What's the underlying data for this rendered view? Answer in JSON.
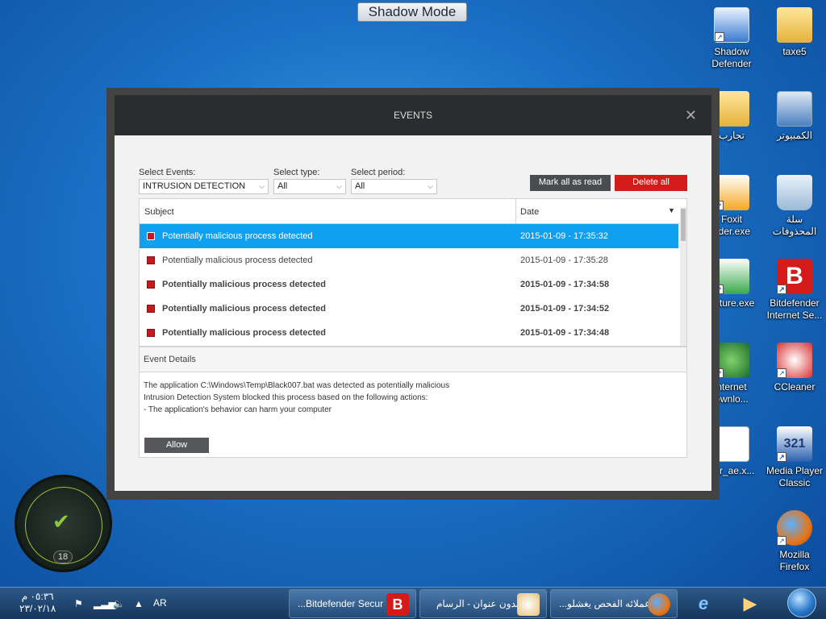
{
  "shadow_banner": "Shadow Mode",
  "desktop_icons": [
    {
      "label": "Shadow Defender",
      "icon": "shadow-defender-icon"
    },
    {
      "label": "taxe5",
      "icon": "folder-user-icon"
    },
    {
      "label": "تجارب",
      "icon": "folder-icon"
    },
    {
      "label": "الكمبيوتر",
      "icon": "computer-icon"
    },
    {
      "label": "Foxit\nader.exe",
      "icon": "foxit-icon"
    },
    {
      "label": "سلة المحذوفات",
      "icon": "recycle-bin-icon"
    },
    {
      "label": "apture.exe",
      "icon": "capture-icon"
    },
    {
      "label": "Bitdefender Internet Se...",
      "icon": "bitdefender-icon"
    },
    {
      "label": "nternet\nownlo...",
      "icon": "internet-download-icon"
    },
    {
      "label": "CCleaner",
      "icon": "ccleaner-icon"
    },
    {
      "label": "_ar_ae.x...",
      "icon": "document-icon"
    },
    {
      "label": "Media Player Classic",
      "icon": "media-player-icon"
    },
    {
      "label": "Mozilla Firefox",
      "icon": "firefox-icon"
    }
  ],
  "window": {
    "title": "EVENTS",
    "close": "✕",
    "filters": {
      "events_label": "Select Events:",
      "events_value": "INTRUSION DETECTION",
      "type_label": "Select type:",
      "type_value": "All",
      "period_label": "Select period:",
      "period_value": "All"
    },
    "mark_all_read": "Mark all as read",
    "delete_all": "Delete all",
    "table": {
      "col_subject": "Subject",
      "col_date": "Date",
      "rows": [
        {
          "subject": "Potentially malicious process detected",
          "date": "2015-01-09 - 17:35:32"
        },
        {
          "subject": "Potentially malicious process detected",
          "date": "2015-01-09 - 17:35:28"
        },
        {
          "subject": "Potentially malicious process detected",
          "date": "2015-01-09 - 17:34:58"
        },
        {
          "subject": "Potentially malicious process detected",
          "date": "2015-01-09 - 17:34:52"
        },
        {
          "subject": "Potentially malicious process detected",
          "date": "2015-01-09 - 17:34:48"
        }
      ]
    },
    "details": {
      "header": "Event Details",
      "line1": "The application C:\\Windows\\Temp\\Black007.bat was detected as potentially malicious",
      "line2": "Intrusion Detection System blocked this process based on the following actions:",
      "line3": "- The application's behavior can harm your computer",
      "allow": "Allow"
    }
  },
  "gadget": {
    "count": "18"
  },
  "taskbar": {
    "time": "٠٥:٣٦ م",
    "date": "٢٣/٠٢/١٨",
    "language": "AR",
    "buttons": [
      {
        "label": "...Bitdefender Secur"
      },
      {
        "label": "بدون عنوان - الرسام"
      },
      {
        "label": "...عملائه الفحص يغشلو"
      }
    ]
  }
}
